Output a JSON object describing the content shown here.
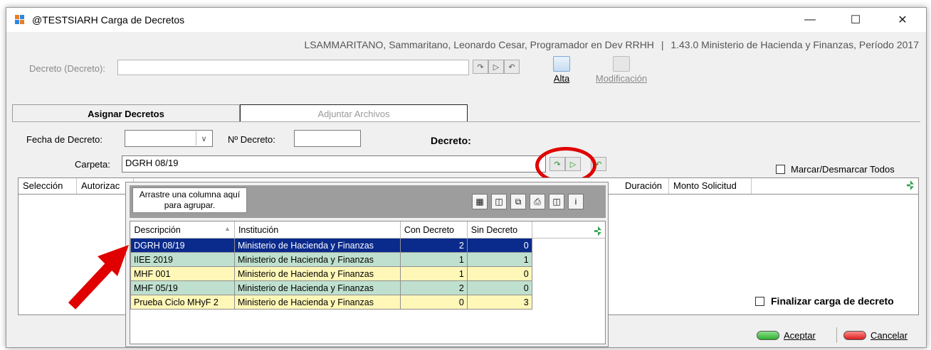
{
  "window": {
    "title": "@TESTSIARH Carga de Decretos",
    "minimize": "—",
    "maximize": "☐",
    "close": "✕"
  },
  "infobar": {
    "user": "LSAMMARITANO, Sammaritano, Leonardo Cesar, Programador en Dev RRHH",
    "separator": "|",
    "version": "1.43.0 Ministerio de Hacienda y Finanzas, Período 2017"
  },
  "decreto_search": {
    "label": "Decreto (Decreto):",
    "value": ""
  },
  "toolbar": {
    "alta_label": "Alta",
    "modificacion_label": "Modificación"
  },
  "tabs": [
    {
      "label": "Asignar Decretos",
      "active": true
    },
    {
      "label": "Adjuntar Archivos",
      "active": false
    }
  ],
  "form": {
    "fecha_label": "Fecha de Decreto:",
    "fecha_value": "",
    "numero_label": "Nº Decreto:",
    "numero_value": "",
    "decreto_label": "Decreto:",
    "carpeta_label": "Carpeta:",
    "carpeta_value": "DGRH 08/19",
    "marcar_label": "Marcar/Desmarcar Todos"
  },
  "grid": {
    "columns": [
      "Selección",
      "Autorizac",
      "Duración",
      "Monto Solicitud"
    ]
  },
  "popup": {
    "group_hint": "Arrastre una columna aquí para agrupar.",
    "columns": [
      "Descripción",
      "Institución",
      "Con Decreto",
      "Sin Decreto"
    ],
    "rows": [
      {
        "descripcion": "DGRH 08/19",
        "institucion": "Ministerio de Hacienda y Finanzas",
        "con": "2",
        "sin": "0",
        "style": "selected"
      },
      {
        "descripcion": "IIEE 2019",
        "institucion": "Ministerio de Hacienda y Finanzas",
        "con": "1",
        "sin": "1",
        "style": "green"
      },
      {
        "descripcion": "MHF 001",
        "institucion": "Ministerio de Hacienda y Finanzas",
        "con": "1",
        "sin": "0",
        "style": "yellow"
      },
      {
        "descripcion": "MHF 05/19",
        "institucion": "Ministerio de Hacienda y Finanzas",
        "con": "2",
        "sin": "0",
        "style": "green"
      },
      {
        "descripcion": "Prueba Ciclo MHyF 2",
        "institucion": "Ministerio de Hacienda y Finanzas",
        "con": "0",
        "sin": "3",
        "style": "yellow"
      }
    ]
  },
  "finalizar_label": "Finalizar carga de decreto",
  "footer": {
    "aceptar_label": "Aceptar",
    "cancelar_label": "Cancelar"
  },
  "colors": {
    "selected_row": "#0a2a8c",
    "row_yellow": "#fff7b8",
    "row_green": "#bfe0cf",
    "annotation_red": "#e00000"
  }
}
